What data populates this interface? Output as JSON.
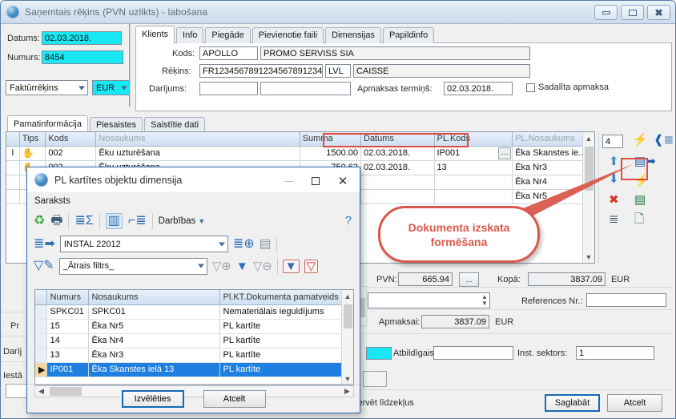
{
  "window": {
    "title": "Saņemtais rēķins (PVN uzlikts) - labošana",
    "buttons": {
      "minimize": "minimize-icon",
      "maximize": "maximize-icon",
      "close": "close-icon"
    }
  },
  "header_form": {
    "datums_label": "Datums:",
    "datums_value": "02.03.2018.",
    "numurs_label": "Numurs:",
    "numurs_value": "8454",
    "doc_type": "Faktūrrēķins",
    "currency": "EUR"
  },
  "tabs": {
    "items": [
      {
        "label": "Klients",
        "active": true
      },
      {
        "label": "Info",
        "active": false
      },
      {
        "label": "Piegāde",
        "active": false
      },
      {
        "label": "Pievienotie faili",
        "active": false
      },
      {
        "label": "Dimensijas",
        "active": false
      },
      {
        "label": "Papildinfo",
        "active": false
      }
    ]
  },
  "client_tab": {
    "kods_label": "Kods:",
    "kods_value": "APOLLO",
    "client_name": "PROMO SERVISS SIA",
    "rekins_label": "Rēķins:",
    "rekins_value": "FR1234567891234567891234",
    "lvl_value": "LVL",
    "caisse_value": "CAISSE",
    "darijums_label": "Darījums:",
    "darijums_value": "",
    "darijums_value2": "",
    "apmaksas_label": "Apmaksas termiņš:",
    "apmaksas_value": "02.03.2018.",
    "sadalita_label": "Sadalīta apmaksa"
  },
  "lower_tabs": {
    "items": [
      {
        "label": "Pamatinformācija",
        "active": true
      },
      {
        "label": "Piesaistes",
        "active": false
      },
      {
        "label": "Saistītie dati",
        "active": false
      }
    ]
  },
  "lines_grid": {
    "columns": [
      "",
      "Tips",
      "Kods",
      "Nosaukums",
      "Summa",
      "Datums",
      "PL.Kods",
      "PL.Nosaukums"
    ],
    "rows": [
      {
        "mark": "I",
        "tips": "hand-icon",
        "kods": "002",
        "nosaukums": "Ēku uzturēšana",
        "summa": "1500.00",
        "datums": "02.03.2018.",
        "pl_kods": "IP001",
        "pl_nosaukums": "Ēka Skanstes ie..."
      },
      {
        "mark": "",
        "tips": "hand-icon",
        "kods": "002",
        "nosaukums": "Ēku uzturēšana",
        "summa": "750.62",
        "datums": "02.03.2018.",
        "pl_kods": "13",
        "pl_nosaukums": "Ēka Nr3"
      },
      {
        "mark": "",
        "tips": "",
        "kods": "",
        "nosaukums": "",
        "summa": "",
        "datums": "",
        "pl_kods": "",
        "pl_nosaukums": "Ēka Nr4"
      },
      {
        "mark": "",
        "tips": "",
        "kods": "",
        "nosaukums": "",
        "summa": "",
        "datums": "",
        "pl_kods": "",
        "pl_nosaukums": "Ēka Nr5"
      }
    ]
  },
  "side_toolbar": {
    "count_value": "4",
    "icons": [
      "lightning-red-icon",
      "insert-row-blue-icon",
      "arrow-up-blue-icon",
      "document-export-icon",
      "arrow-down-blue-icon",
      "lightning-green-icon",
      "delete-red-x-icon",
      "excel-export-icon",
      "list-structure-icon",
      "add-document-green-icon"
    ]
  },
  "callout": {
    "line1": "Dokumenta izskata",
    "line2": "formēšana",
    "color": "#d9584c"
  },
  "totals": {
    "pvn_label": "PVN:",
    "pvn_value": "665.94",
    "dots_button": "...",
    "kopa_label": "Kopā:",
    "kopa_value": "3837.09",
    "kopa_currency": "EUR",
    "spin_value": "",
    "reference_label": "References Nr.:",
    "reference_value": "",
    "apmaksai_label": "Apmaksai:",
    "apmaksai_value": "3837.09",
    "apmaksai_currency": "EUR",
    "atbildigais_label": "Atbildīgais:",
    "atbildigais_value": "",
    "sektors_label": "Inst. sektors:",
    "sektors_value": "1",
    "reserve_label": "zervēt līdzekļus",
    "save_label": "Saglabāt",
    "cancel_label": "Atcelt"
  },
  "behind_labels": {
    "l1": "Pr",
    "l2": "Darīj",
    "l3": "Iestā"
  },
  "dialog": {
    "title": "PL kartītes objektu dimensija",
    "menu": "Saraksts",
    "toolbar": {
      "refresh": "refresh-icon",
      "print": "print-icon",
      "sum": "sum-list-icon",
      "columns": "columns-icon",
      "tree": "tree-icon",
      "actions_label": "Darbības",
      "help": "help-icon"
    },
    "row2": {
      "left_icon": "list-arrow-icon",
      "combo_value": "INSTAL 22012",
      "add_icon": "add-list-icon",
      "copy_icon": "copy-list-icon"
    },
    "row3": {
      "filter_edit_icon": "filter-edit-icon",
      "combo_value": "_Ātrais filtrs_",
      "add_filter_icon": "add-filter-icon",
      "apply_filter_icon": "apply-filter-icon",
      "remove_filter_icon": "remove-filter-icon",
      "user_filter_icon": "user-filter-icon",
      "clear_filter_icon": "clear-filter-icon"
    },
    "grid": {
      "columns": [
        "Numurs",
        "Nosaukums",
        "Pl.KT.Dokumenta pamatveids"
      ],
      "rows": [
        {
          "numurs": "SPKC01",
          "nosaukums": "SPKC01",
          "veids": "Nemateriālais ieguldījums",
          "selected": false
        },
        {
          "numurs": "15",
          "nosaukums": "Ēka Nr5",
          "veids": "PL kartīte",
          "selected": false
        },
        {
          "numurs": "14",
          "nosaukums": "Ēka Nr4",
          "veids": "PL kartīte",
          "selected": false
        },
        {
          "numurs": "13",
          "nosaukums": "Ēka Nr3",
          "veids": "PL kartīte",
          "selected": false
        },
        {
          "numurs": "IP001",
          "nosaukums": "Ēka Skanstes ielā 13",
          "veids": "PL kartīte",
          "selected": true
        }
      ]
    },
    "footer": {
      "select_label": "Izvēlēties",
      "cancel_label": "Atcelt"
    }
  }
}
